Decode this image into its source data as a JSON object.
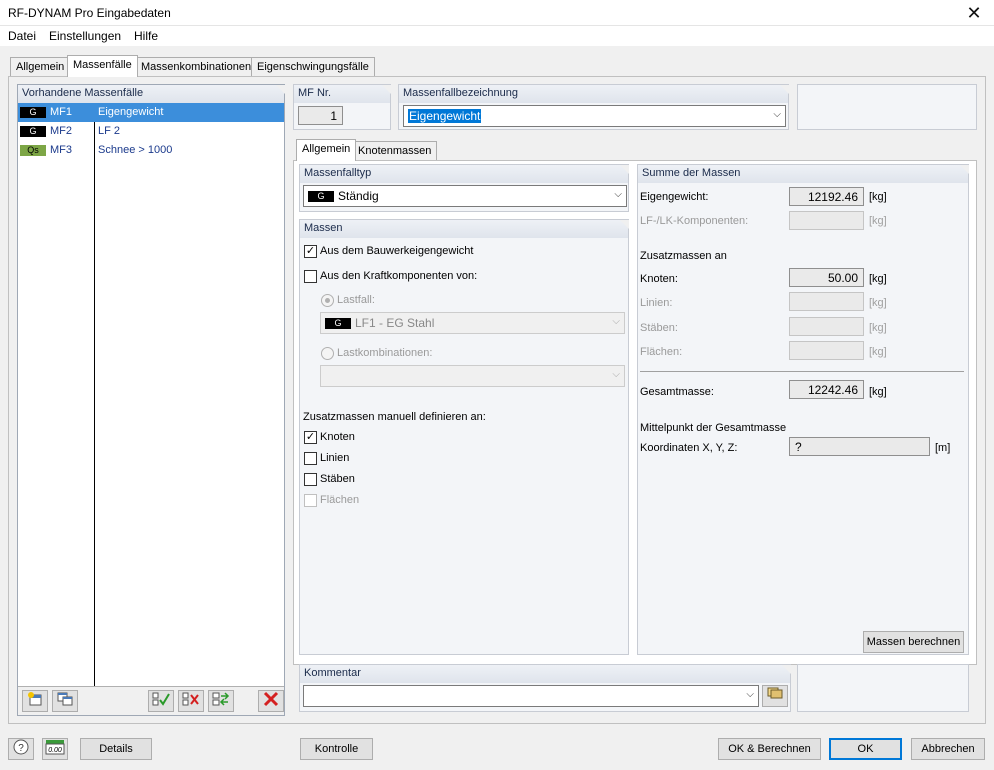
{
  "window": {
    "title": "RF-DYNAM Pro Eingabedaten",
    "close_glyph": "✕"
  },
  "menu": [
    "Datei",
    "Einstellungen",
    "Hilfe"
  ],
  "main_tabs": [
    "Allgemein",
    "Massenfälle",
    "Massenkombinationen",
    "Eigenschwingungsfälle"
  ],
  "mass_cases_list": {
    "header": "Vorhandene Massenfälle",
    "rows": [
      {
        "badge": "G",
        "id": "MF1",
        "name": "Eigengewicht"
      },
      {
        "badge": "G",
        "id": "MF2",
        "name": "LF 2"
      },
      {
        "badge": "Qs",
        "id": "MF3",
        "name": "Schnee > 1000"
      }
    ]
  },
  "mf_nr": {
    "label": "MF Nr.",
    "value": "1"
  },
  "designation": {
    "label": "Massenfallbezeichnung",
    "value": "Eigengewicht"
  },
  "inner_tabs": [
    "Allgemein",
    "Knotenmassen"
  ],
  "mass_case_type": {
    "label": "Massenfalltyp",
    "badge": "G",
    "value": "Ständig"
  },
  "masses": {
    "label": "Massen",
    "from_self_weight": "Aus dem Bauwerkeigengewicht",
    "from_force_components": "Aus den Kraftkomponenten von:",
    "load_case_label": "Lastfall:",
    "load_case_badge": "G",
    "load_case_value": "LF1 - EG Stahl",
    "load_combinations_label": "Lastkombinationen:",
    "manual_label": "Zusatzmassen manuell definieren an:",
    "nodes": "Knoten",
    "lines": "Linien",
    "members": "Stäben",
    "surfaces": "Flächen"
  },
  "sum": {
    "label": "Summe der Massen",
    "self_weight_label": "Eigengewicht:",
    "self_weight_value": "12192.46",
    "lf_components_label": "LF-/LK-Komponenten:",
    "additional_label": "Zusatzmassen an",
    "nodes_label": "Knoten:",
    "nodes_value": "50.00",
    "lines_label": "Linien:",
    "members_label": "Stäben:",
    "surfaces_label": "Flächen:",
    "total_label": "Gesamtmasse:",
    "total_value": "12242.46",
    "unit_kg": "[kg]",
    "center_label": "Mittelpunkt der Gesamtmasse",
    "coords_label": "Koordinaten X, Y, Z:",
    "coords_value": "?",
    "unit_m": "[m]",
    "compute_button": "Massen berechnen"
  },
  "comment": {
    "label": "Kommentar",
    "value": ""
  },
  "footer": {
    "details": "Details",
    "check": "Kontrolle",
    "ok_calc": "OK & Berechnen",
    "ok": "OK",
    "cancel": "Abbrechen",
    "calc_icon_text": "0.00"
  }
}
